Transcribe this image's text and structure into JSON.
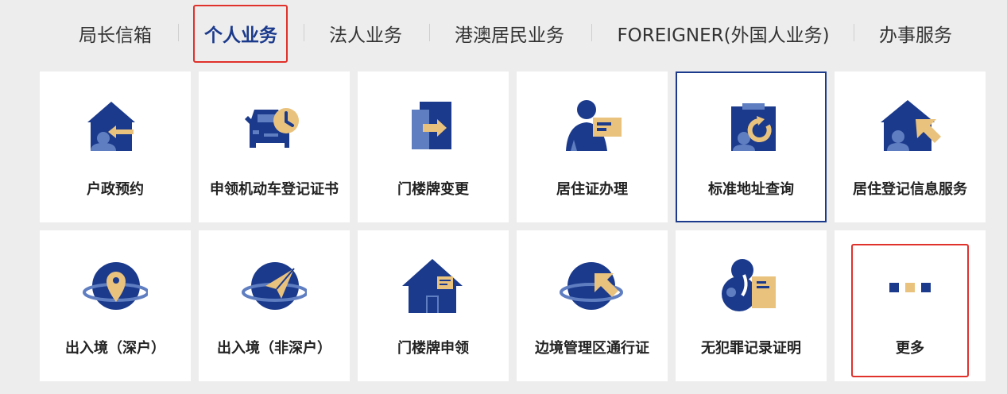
{
  "tabs": [
    {
      "label": "局长信箱"
    },
    {
      "label": "个人业务"
    },
    {
      "label": "法人业务"
    },
    {
      "label": "港澳居民业务"
    },
    {
      "label": "FOREIGNER(外国人业务)"
    },
    {
      "label": "办事服务"
    }
  ],
  "services": [
    {
      "label": "户政预约",
      "icon": "home-return-icon"
    },
    {
      "label": "申领机动车登记证书",
      "icon": "car-clock-icon"
    },
    {
      "label": "门楼牌变更",
      "icon": "doorplate-change-icon"
    },
    {
      "label": "居住证办理",
      "icon": "person-card-icon"
    },
    {
      "label": "标准地址查询",
      "icon": "clipboard-refresh-icon"
    },
    {
      "label": "居住登记信息服务",
      "icon": "home-arrow-icon"
    },
    {
      "label": "出入境（深户）",
      "icon": "globe-location-icon"
    },
    {
      "label": "出入境（非深户）",
      "icon": "globe-plane-icon"
    },
    {
      "label": "门楼牌申领",
      "icon": "house-icon"
    },
    {
      "label": "边境管理区通行证",
      "icon": "globe-cursor-icon"
    },
    {
      "label": "无犯罪记录证明",
      "icon": "person-document-icon"
    },
    {
      "label": "更多",
      "icon": "more-icon"
    }
  ],
  "colors": {
    "primary": "#1b3a8c",
    "accent": "#e9c27e",
    "light": "#5f7ec1",
    "highlight": "#e0312b"
  }
}
